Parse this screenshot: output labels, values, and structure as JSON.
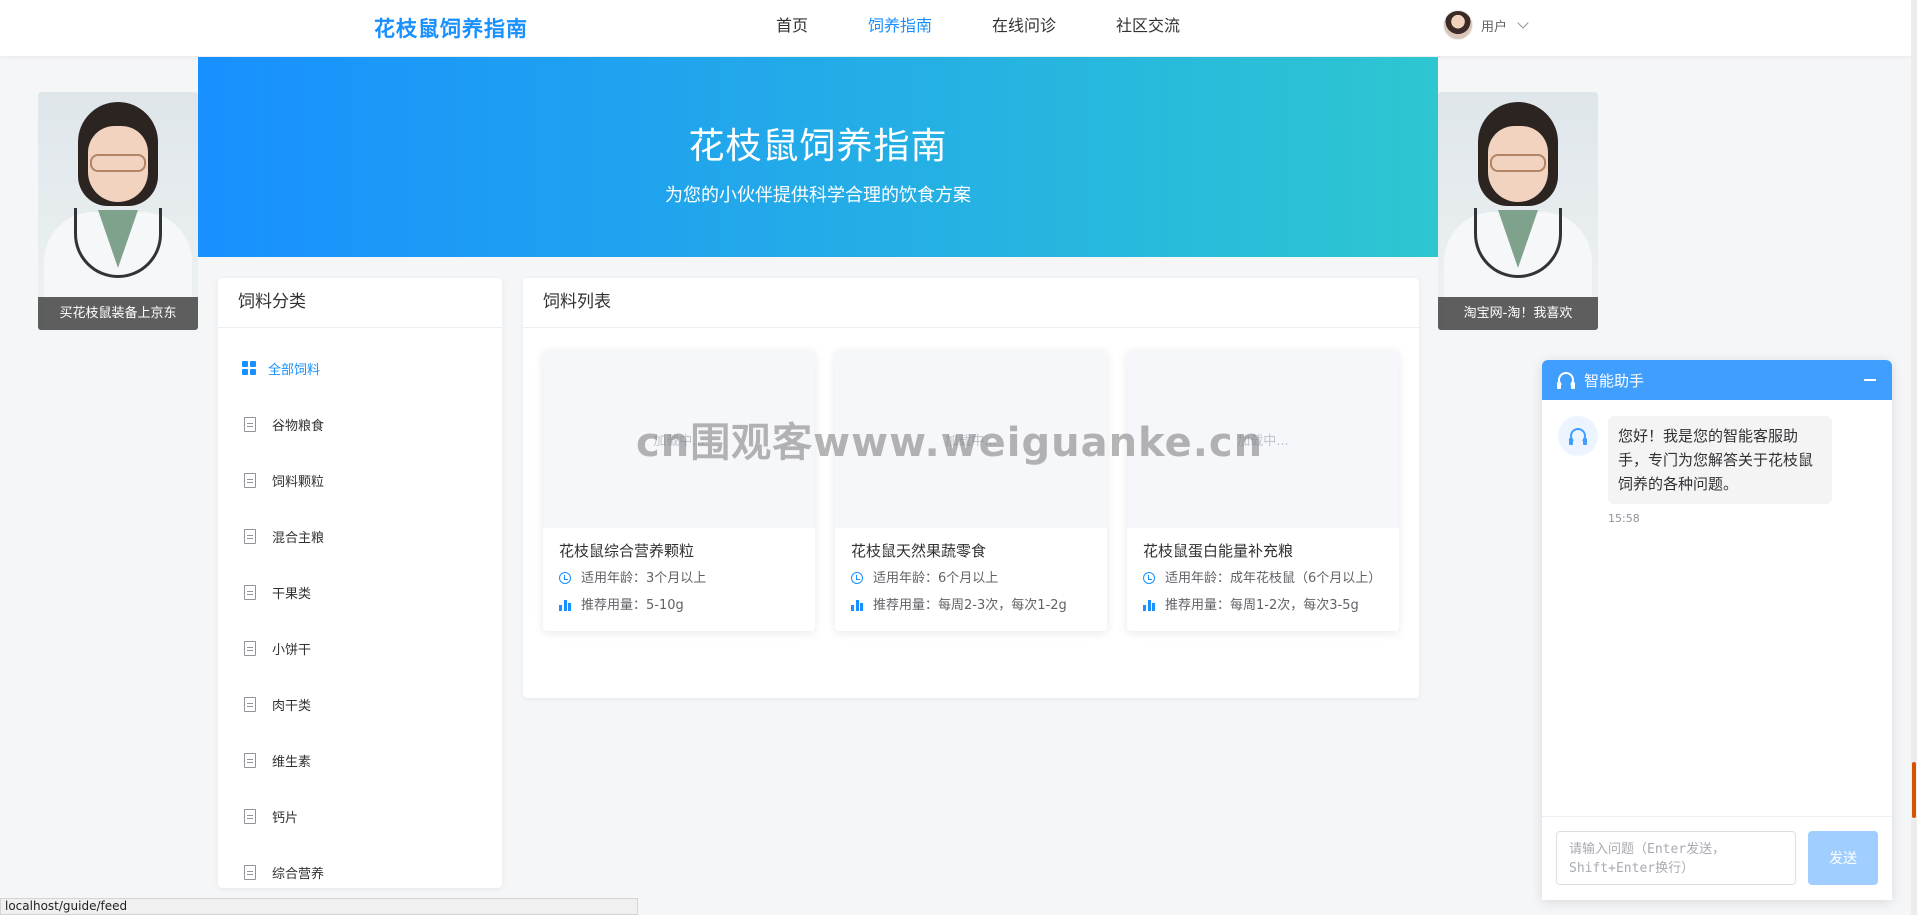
{
  "header": {
    "logo": "花枝鼠饲养指南",
    "nav": [
      {
        "label": "首页"
      },
      {
        "label": "饲养指南"
      },
      {
        "label": "在线问诊"
      },
      {
        "label": "社区交流"
      }
    ],
    "user_label": "用户"
  },
  "banner": {
    "title": "花枝鼠饲养指南",
    "subtitle": "为您的小伙伴提供科学合理的饮食方案"
  },
  "ads": {
    "left_caption": "买花枝鼠装备上京东",
    "right_caption": "淘宝网-淘！我喜欢"
  },
  "categories": {
    "title": "饲料分类",
    "items": [
      {
        "label": "全部饲料"
      },
      {
        "label": "谷物粮食"
      },
      {
        "label": "饲料颗粒"
      },
      {
        "label": "混合主粮"
      },
      {
        "label": "干果类"
      },
      {
        "label": "小饼干"
      },
      {
        "label": "肉干类"
      },
      {
        "label": "维生素"
      },
      {
        "label": "钙片"
      },
      {
        "label": "综合营养"
      }
    ]
  },
  "feed_list": {
    "title": "饲料列表",
    "cards": [
      {
        "image_text": "加载中...",
        "name": "花枝鼠综合营养颗粒",
        "age_label": "适用年龄：",
        "age": "3个月以上",
        "dose_label": "推荐用量：",
        "dose": "5-10g"
      },
      {
        "image_text": "加载中...",
        "name": "花枝鼠天然果蔬零食",
        "age_label": "适用年龄：",
        "age": "6个月以上",
        "dose_label": "推荐用量：",
        "dose": "每周2-3次，每次1-2g"
      },
      {
        "image_text": "加载中...",
        "name": "花枝鼠蛋白能量补充粮",
        "age_label": "适用年龄：",
        "age": "成年花枝鼠（6个月以上）",
        "dose_label": "推荐用量：",
        "dose": "每周1-2次，每次3-5g"
      }
    ]
  },
  "watermark": "cn围观客www.weiguanke.cn",
  "chat": {
    "title": "智能助手",
    "message": "您好！我是您的智能客服助手，专门为您解答关于花枝鼠饲养的各种问题。",
    "time": "15:58",
    "input_placeholder": "请输入问题（Enter发送，Shift+Enter换行）",
    "send_label": "发送"
  },
  "status_url": "localhost/guide/feed",
  "colors": {
    "accent": "#1890ff",
    "banner_end": "#2ec6d1",
    "chat_header": "#409eff"
  }
}
